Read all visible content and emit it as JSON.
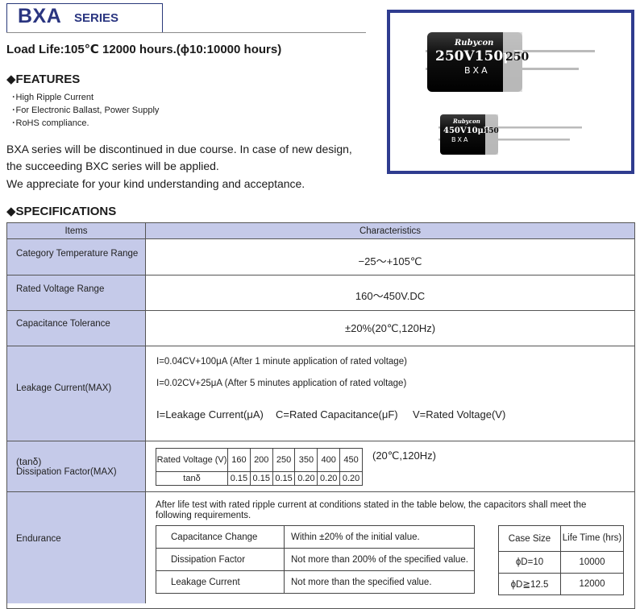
{
  "header": {
    "series_name": "BXA",
    "series_word": "SERIES",
    "load_life": "Load Life:105℃ 12000 hours.(ϕ10:10000 hours)"
  },
  "features": {
    "title": "◆FEATURES",
    "items": [
      "･High Ripple Current",
      "･For Electronic Ballast, Power Supply",
      "･RoHS compliance."
    ]
  },
  "notice": [
    "BXA series will be discontinued in due course.  In case of new design,",
    "the succeeding BXC series  will be applied.",
    "We appreciate for your kind understanding and acceptance."
  ],
  "photo": {
    "large_cap": {
      "brand": "Rubycon",
      "marking": "250V150μF",
      "marking_side": "250",
      "series": "BXA"
    },
    "small_cap": {
      "brand": "Rubycon",
      "marking": "450V10μF",
      "marking_side": "450",
      "series": "BXA"
    }
  },
  "specifications": {
    "title": "◆SPECIFICATIONS",
    "col_items": "Items",
    "col_characteristics": "Characteristics",
    "category_temp": {
      "label": "Category Temperature Range",
      "value": "−25～+105℃"
    },
    "rated_voltage": {
      "label": "Rated Voltage Range",
      "value": "160～450V.DC"
    },
    "cap_tolerance": {
      "label": "Capacitance Tolerance",
      "value": "±20%(20℃,120Hz)"
    },
    "leakage": {
      "label": "Leakage Current(MAX)",
      "line1": "I=0.04CV+100μA (After 1 minute application of rated voltage)",
      "line2": "I=0.02CV+25μA (After 5 minutes application of rated voltage)",
      "legend_i": "I=Leakage Current(μA)",
      "legend_c": "C=Rated Capacitance(μF)",
      "legend_v": "V=Rated Voltage(V)"
    },
    "dissipation": {
      "label1": "(tanδ)",
      "label2": "Dissipation Factor(MAX)",
      "condition": "(20℃,120Hz)",
      "row_voltage_label": "Rated Voltage (V)",
      "row_tan_label": "tanδ",
      "voltages": [
        "160",
        "200",
        "250",
        "350",
        "400",
        "450"
      ],
      "tan_values": [
        "0.15",
        "0.15",
        "0.15",
        "0.20",
        "0.20",
        "0.20"
      ]
    },
    "endurance": {
      "label": "Endurance",
      "description": "After life test with rated ripple current at conditions stated in the table below, the capacitors shall meet the following requirements.",
      "rows": [
        {
          "item": "Capacitance Change",
          "value": "Within ±20% of the initial value."
        },
        {
          "item": "Dissipation Factor",
          "value": "Not more than 200% of the specified value."
        },
        {
          "item": "Leakage Current",
          "value": "Not more than the specified value."
        }
      ],
      "life_header_case": "Case Size",
      "life_header_time": "Life Time (hrs)",
      "life_rows": [
        {
          "case": "ϕD=10",
          "time": "10000"
        },
        {
          "case": "ϕD≧12.5",
          "time": "12000"
        }
      ]
    }
  }
}
